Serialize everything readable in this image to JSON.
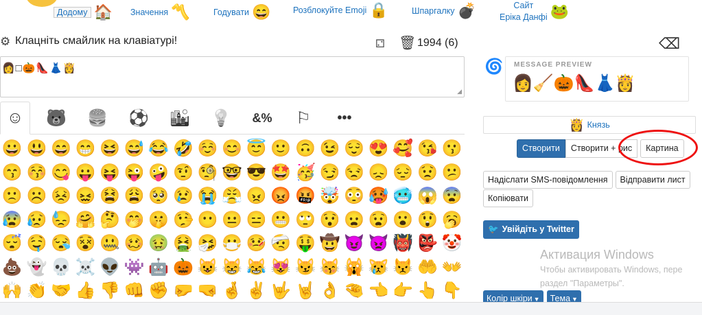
{
  "nav": {
    "items": [
      {
        "label": "Додому",
        "emoji": "🏠"
      },
      {
        "label": "Значення",
        "emoji": "〽️"
      },
      {
        "label": "Годувати",
        "emoji": "😄"
      },
      {
        "label": "Розблокуйте Emoji",
        "emoji": "🔒"
      },
      {
        "label": "Шпаргалку",
        "emoji": "💣"
      },
      {
        "label_line1": "Сайт",
        "label_line2": "Еріка Данфі",
        "emoji": "🐸"
      }
    ]
  },
  "composer": {
    "prompt": "Клацніть смайлик на клавіатурі!",
    "counter": "1994 (6)",
    "text": "👩□🎃👠👗👸"
  },
  "tabs": [
    {
      "name": "smileys",
      "glyph": "☺"
    },
    {
      "name": "animals",
      "glyph": "🐻"
    },
    {
      "name": "food",
      "glyph": "🍔"
    },
    {
      "name": "sport",
      "glyph": "⚽"
    },
    {
      "name": "travel",
      "glyph": "🏙"
    },
    {
      "name": "objects",
      "glyph": "💡"
    },
    {
      "name": "symbols",
      "glyph": "&%"
    },
    {
      "name": "flags",
      "glyph": "⚐"
    },
    {
      "name": "more",
      "glyph": "•••"
    }
  ],
  "emoji_grid": [
    "😀",
    "😃",
    "😄",
    "😁",
    "😆",
    "😅",
    "😂",
    "🤣",
    "☺️",
    "😊",
    "😇",
    "🙂",
    "🙃",
    "😉",
    "😌",
    "😍",
    "🥰",
    "😘",
    "😗",
    "😙",
    "😚",
    "😋",
    "😛",
    "😝",
    "😜",
    "🤪",
    "🤨",
    "🧐",
    "🤓",
    "😎",
    "🤩",
    "🥳",
    "😏",
    "😒",
    "😞",
    "😔",
    "😟",
    "😕",
    "🙁",
    "☹️",
    "😣",
    "😖",
    "😫",
    "😩",
    "🥺",
    "😢",
    "😭",
    "😤",
    "😠",
    "😡",
    "🤬",
    "🤯",
    "😳",
    "🥵",
    "🥶",
    "😱",
    "😨",
    "😰",
    "😥",
    "😓",
    "🤗",
    "🤔",
    "🤭",
    "🤫",
    "🤥",
    "😶",
    "😐",
    "😑",
    "😬",
    "🙄",
    "😯",
    "😦",
    "😧",
    "😮",
    "😲",
    "🥱",
    "😴",
    "🤤",
    "😪",
    "😵",
    "🤐",
    "🥴",
    "🤢",
    "🤮",
    "🤧",
    "😷",
    "🤒",
    "🤕",
    "🤑",
    "🤠",
    "😈",
    "👿",
    "👹",
    "👺",
    "🤡",
    "💩",
    "👻",
    "💀",
    "☠️",
    "👽",
    "👾",
    "🤖",
    "🎃",
    "😺",
    "😸",
    "😹",
    "😻",
    "😼",
    "😽",
    "🙀",
    "😿",
    "😾",
    "🤲",
    "👐",
    "🙌",
    "👏",
    "🤝",
    "👍",
    "👎",
    "👊",
    "✊",
    "🤛",
    "🤜",
    "🤞",
    "✌️",
    "🤟",
    "🤘",
    "👌",
    "🤏",
    "👈",
    "👉",
    "👆",
    "👇",
    "☝️",
    "✋"
  ],
  "preview": {
    "label": "MESSAGE PREVIEW",
    "emojis": "👩🧹🎃👠👗👸"
  },
  "name_box": {
    "emoji": "👸",
    "text": "Князь"
  },
  "buttons": {
    "create": "Створити",
    "create_pic": "Створити + рис",
    "picture": "Картина",
    "sms": "Надіслати SMS-повідомлення",
    "email": "Відправити лист",
    "copy": "Копіювати",
    "twitter": "Увійдіть у Twitter"
  },
  "windows_activation": {
    "title": "Активация Windows",
    "line1": "Чтобы активировать Windows, пере",
    "line2": "раздел \"Параметры\"."
  },
  "dropdowns": {
    "skin": "Колір шкіри",
    "theme": "Тема"
  },
  "colors": {
    "link": "#1e73be",
    "primary": "#2f6fad",
    "highlight_circle": "#ee1111"
  }
}
